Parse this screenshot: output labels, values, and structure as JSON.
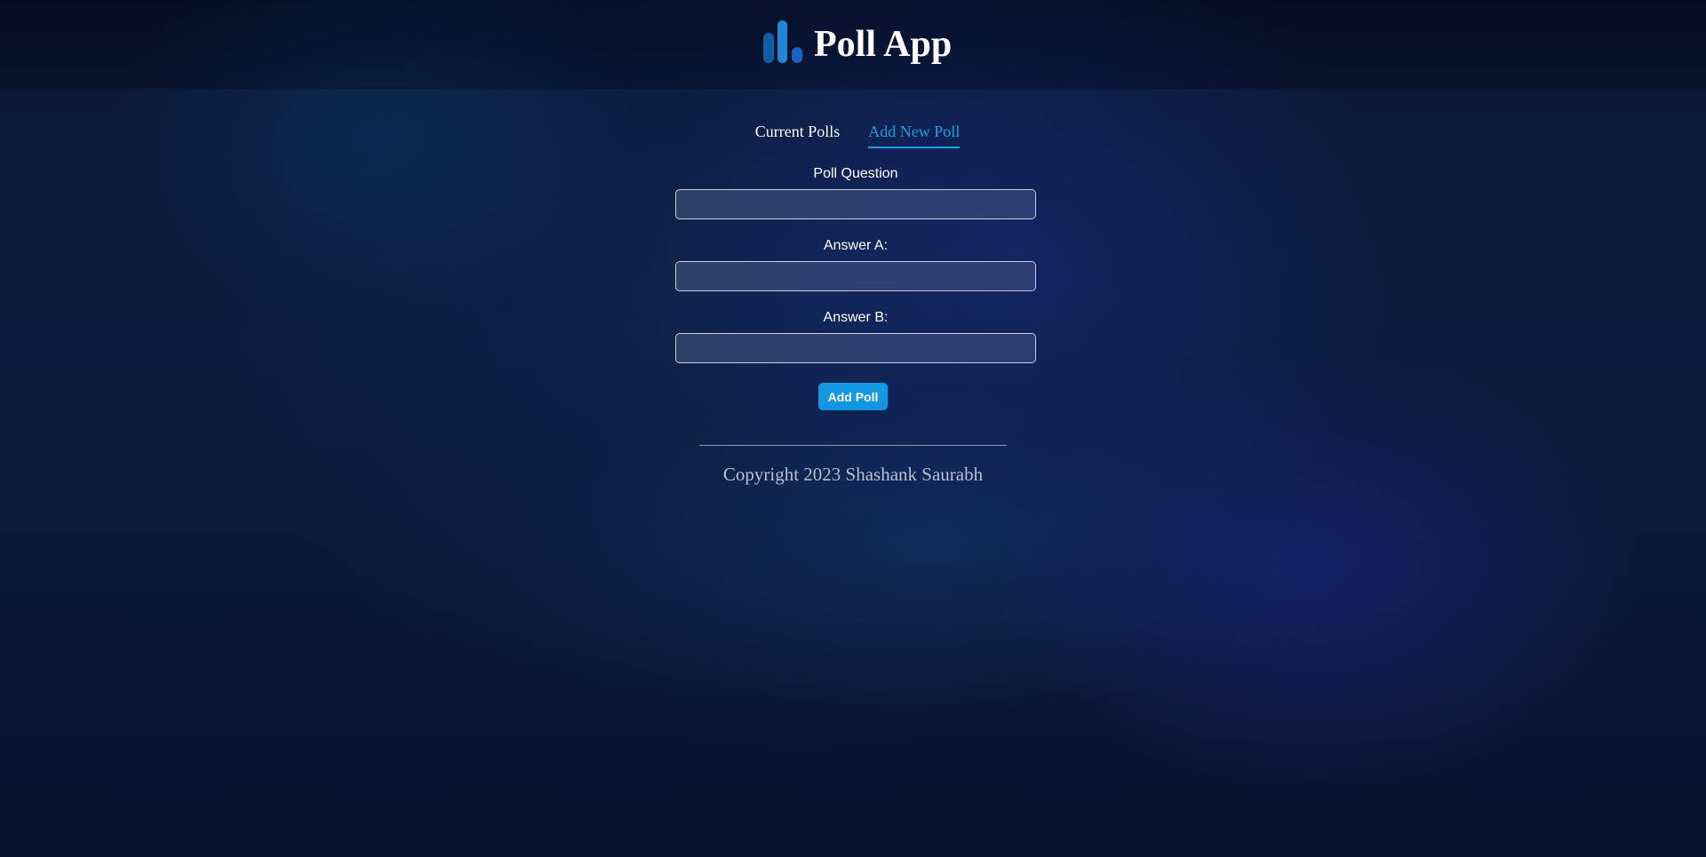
{
  "header": {
    "title": "Poll App",
    "logo_icon": "bar-chart-icon",
    "logo_colors": [
      "#0f5ea8",
      "#1e88d8",
      "#1565c0"
    ]
  },
  "tabs": [
    {
      "label": "Current Polls",
      "active": false
    },
    {
      "label": "Add New Poll",
      "active": true
    }
  ],
  "form": {
    "question_label": "Poll Question",
    "question_value": "",
    "answer_a_label": "Answer A:",
    "answer_a_value": "",
    "answer_b_label": "Answer B:",
    "answer_b_value": "",
    "submit_label": "Add Poll"
  },
  "footer": {
    "copyright": "Copyright 2023 Shashank Saurabh"
  },
  "colors": {
    "accent": "#1e9de8",
    "button": "#1397e3",
    "background": "#0a1330"
  }
}
